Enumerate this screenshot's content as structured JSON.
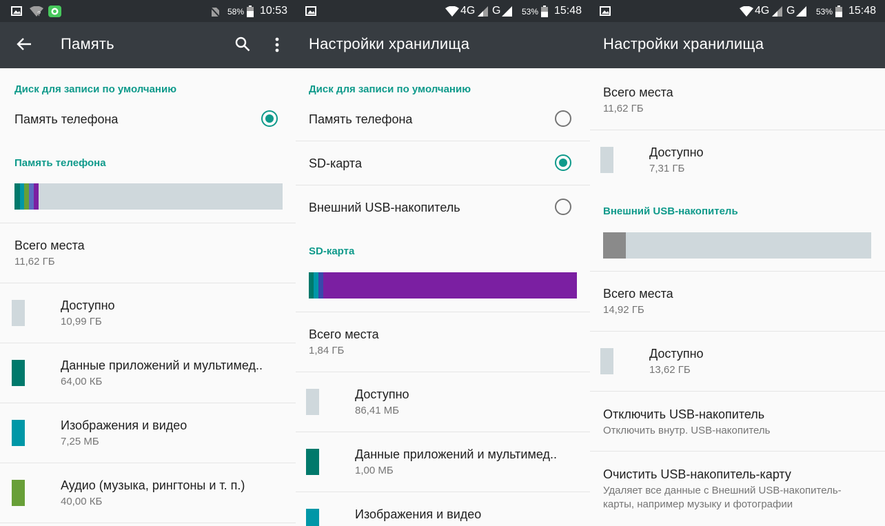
{
  "colors": {
    "accent": "#0f9a8b",
    "free": "#cfd8dc",
    "apps": "#00796b",
    "images": "#0097a7",
    "audio": "#689f38",
    "sd_purple": "#7b1fa2",
    "usb_used": "#8a8a8a"
  },
  "screen1": {
    "status": {
      "battery": "58%",
      "time": "10:53"
    },
    "appbar": {
      "title": "Память",
      "back_icon": "arrow-back-icon",
      "search_icon": "search-icon",
      "menu_icon": "more-vert-icon"
    },
    "default_disk_header": "Диск для записи по умолчанию",
    "default_disk_option": "Память телефона",
    "storage_header": "Память телефона",
    "total": {
      "label": "Всего места",
      "value": "11,62 ГБ"
    },
    "items": [
      {
        "label": "Доступно",
        "value": "10,99 ГБ",
        "color": "#cfd8dc"
      },
      {
        "label": "Данные приложений и мультимед..",
        "value": "64,00 КБ",
        "color": "#00796b"
      },
      {
        "label": "Изображения и видео",
        "value": "7,25 МБ",
        "color": "#0097a7"
      },
      {
        "label": "Аудио (музыка, рингтоны и т. п.)",
        "value": "40,00 КБ",
        "color": "#689f38"
      }
    ]
  },
  "screen2": {
    "status": {
      "network": "4G",
      "network2": "G",
      "battery": "53%",
      "time": "15:48"
    },
    "appbar": {
      "title": "Настройки хранилища"
    },
    "default_disk_header": "Диск для записи по умолчанию",
    "options": [
      {
        "label": "Память телефона",
        "selected": false
      },
      {
        "label": "SD-карта",
        "selected": true
      },
      {
        "label": "Внешний USB-накопитель",
        "selected": false
      }
    ],
    "sd_header": "SD-карта",
    "total": {
      "label": "Всего места",
      "value": "1,84 ГБ"
    },
    "items": [
      {
        "label": "Доступно",
        "value": "86,41 МБ",
        "color": "#cfd8dc"
      },
      {
        "label": "Данные приложений и мультимед..",
        "value": "1,00 МБ",
        "color": "#00796b"
      },
      {
        "label": "Изображения и видео",
        "value": "",
        "color": "#0097a7"
      }
    ]
  },
  "screen3": {
    "status": {
      "network": "4G",
      "network2": "G",
      "battery": "53%",
      "time": "15:48"
    },
    "appbar": {
      "title": "Настройки хранилища"
    },
    "sd_total": {
      "label": "Всего места",
      "value": "11,62 ГБ"
    },
    "sd_free": {
      "label": "Доступно",
      "value": "7,31 ГБ"
    },
    "usb_header": "Внешний USB-накопитель",
    "usb_total": {
      "label": "Всего места",
      "value": "14,92 ГБ"
    },
    "usb_free": {
      "label": "Доступно",
      "value": "13,62 ГБ"
    },
    "unmount": {
      "title": "Отключить USB-накопитель",
      "subtitle": "Отключить внутр. USB-накопитель"
    },
    "erase": {
      "title": "Очистить USB-накопитель-карту",
      "subtitle_line1": "Удаляет все данные с Внешний USB-накопитель-",
      "subtitle_line2": "карты, например музыку и фотографии"
    }
  }
}
